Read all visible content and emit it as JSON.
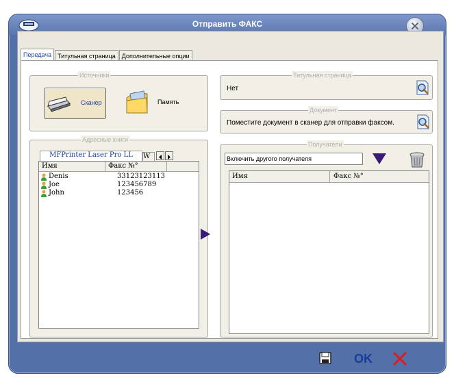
{
  "window": {
    "title": "Отправить ФАКС"
  },
  "tabs": [
    {
      "label": "Передача",
      "active": true
    },
    {
      "label": "Титульная страница",
      "active": false
    },
    {
      "label": "Дополнительные опции",
      "active": false
    }
  ],
  "sources": {
    "legend": "Источники",
    "scanner_label": "Сканер",
    "memory_label": "Память"
  },
  "address_books": {
    "legend": "Адресные книги",
    "tab1": "MFPrinter Laser Pro LL",
    "tab2": "W",
    "columns": [
      "Имя",
      "Факс №°"
    ],
    "rows": [
      {
        "name": "Denis",
        "fax": "33123123113"
      },
      {
        "name": "Joe",
        "fax": "123456789"
      },
      {
        "name": "John",
        "fax": "123456"
      }
    ]
  },
  "cover_page": {
    "legend": "Титульная страница",
    "value": "Нет"
  },
  "document": {
    "legend": "Документ",
    "text": "Поместите документ в сканер для отправки факсом."
  },
  "recipients": {
    "legend": "Получатели",
    "input_value": "Включить другого получателя",
    "columns": [
      "Имя",
      "Факс №°"
    ]
  },
  "footer": {
    "ok_label": "OK"
  },
  "colors": {
    "accent": "#5470a8",
    "arrow": "#3a1a78",
    "ok": "#1a3c9a",
    "cancel": "#e01818"
  }
}
